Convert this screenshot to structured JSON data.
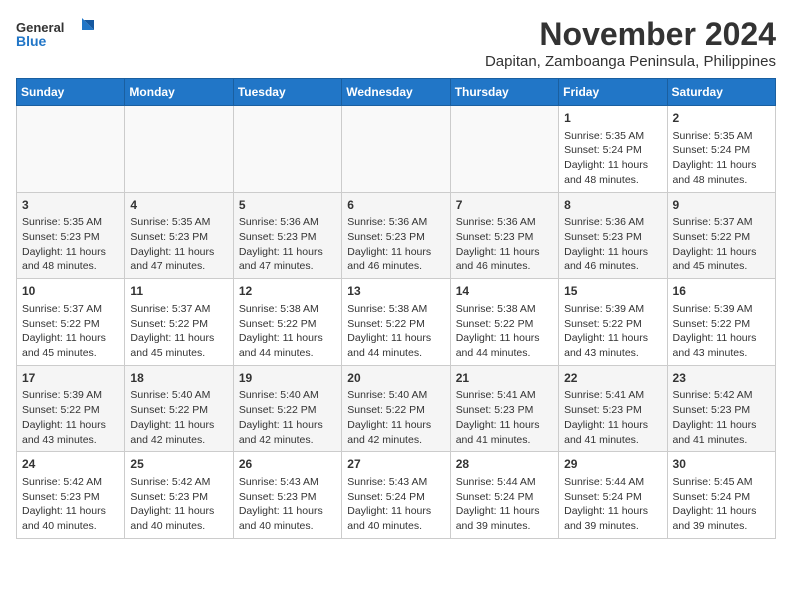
{
  "header": {
    "logo_line1": "General",
    "logo_line2": "Blue",
    "title": "November 2024",
    "subtitle": "Dapitan, Zamboanga Peninsula, Philippines"
  },
  "weekdays": [
    "Sunday",
    "Monday",
    "Tuesday",
    "Wednesday",
    "Thursday",
    "Friday",
    "Saturday"
  ],
  "weeks": [
    [
      {
        "day": "",
        "info": ""
      },
      {
        "day": "",
        "info": ""
      },
      {
        "day": "",
        "info": ""
      },
      {
        "day": "",
        "info": ""
      },
      {
        "day": "",
        "info": ""
      },
      {
        "day": "1",
        "info": "Sunrise: 5:35 AM\nSunset: 5:24 PM\nDaylight: 11 hours\nand 48 minutes."
      },
      {
        "day": "2",
        "info": "Sunrise: 5:35 AM\nSunset: 5:24 PM\nDaylight: 11 hours\nand 48 minutes."
      }
    ],
    [
      {
        "day": "3",
        "info": "Sunrise: 5:35 AM\nSunset: 5:23 PM\nDaylight: 11 hours\nand 48 minutes."
      },
      {
        "day": "4",
        "info": "Sunrise: 5:35 AM\nSunset: 5:23 PM\nDaylight: 11 hours\nand 47 minutes."
      },
      {
        "day": "5",
        "info": "Sunrise: 5:36 AM\nSunset: 5:23 PM\nDaylight: 11 hours\nand 47 minutes."
      },
      {
        "day": "6",
        "info": "Sunrise: 5:36 AM\nSunset: 5:23 PM\nDaylight: 11 hours\nand 46 minutes."
      },
      {
        "day": "7",
        "info": "Sunrise: 5:36 AM\nSunset: 5:23 PM\nDaylight: 11 hours\nand 46 minutes."
      },
      {
        "day": "8",
        "info": "Sunrise: 5:36 AM\nSunset: 5:23 PM\nDaylight: 11 hours\nand 46 minutes."
      },
      {
        "day": "9",
        "info": "Sunrise: 5:37 AM\nSunset: 5:22 PM\nDaylight: 11 hours\nand 45 minutes."
      }
    ],
    [
      {
        "day": "10",
        "info": "Sunrise: 5:37 AM\nSunset: 5:22 PM\nDaylight: 11 hours\nand 45 minutes."
      },
      {
        "day": "11",
        "info": "Sunrise: 5:37 AM\nSunset: 5:22 PM\nDaylight: 11 hours\nand 45 minutes."
      },
      {
        "day": "12",
        "info": "Sunrise: 5:38 AM\nSunset: 5:22 PM\nDaylight: 11 hours\nand 44 minutes."
      },
      {
        "day": "13",
        "info": "Sunrise: 5:38 AM\nSunset: 5:22 PM\nDaylight: 11 hours\nand 44 minutes."
      },
      {
        "day": "14",
        "info": "Sunrise: 5:38 AM\nSunset: 5:22 PM\nDaylight: 11 hours\nand 44 minutes."
      },
      {
        "day": "15",
        "info": "Sunrise: 5:39 AM\nSunset: 5:22 PM\nDaylight: 11 hours\nand 43 minutes."
      },
      {
        "day": "16",
        "info": "Sunrise: 5:39 AM\nSunset: 5:22 PM\nDaylight: 11 hours\nand 43 minutes."
      }
    ],
    [
      {
        "day": "17",
        "info": "Sunrise: 5:39 AM\nSunset: 5:22 PM\nDaylight: 11 hours\nand 43 minutes."
      },
      {
        "day": "18",
        "info": "Sunrise: 5:40 AM\nSunset: 5:22 PM\nDaylight: 11 hours\nand 42 minutes."
      },
      {
        "day": "19",
        "info": "Sunrise: 5:40 AM\nSunset: 5:22 PM\nDaylight: 11 hours\nand 42 minutes."
      },
      {
        "day": "20",
        "info": "Sunrise: 5:40 AM\nSunset: 5:22 PM\nDaylight: 11 hours\nand 42 minutes."
      },
      {
        "day": "21",
        "info": "Sunrise: 5:41 AM\nSunset: 5:23 PM\nDaylight: 11 hours\nand 41 minutes."
      },
      {
        "day": "22",
        "info": "Sunrise: 5:41 AM\nSunset: 5:23 PM\nDaylight: 11 hours\nand 41 minutes."
      },
      {
        "day": "23",
        "info": "Sunrise: 5:42 AM\nSunset: 5:23 PM\nDaylight: 11 hours\nand 41 minutes."
      }
    ],
    [
      {
        "day": "24",
        "info": "Sunrise: 5:42 AM\nSunset: 5:23 PM\nDaylight: 11 hours\nand 40 minutes."
      },
      {
        "day": "25",
        "info": "Sunrise: 5:42 AM\nSunset: 5:23 PM\nDaylight: 11 hours\nand 40 minutes."
      },
      {
        "day": "26",
        "info": "Sunrise: 5:43 AM\nSunset: 5:23 PM\nDaylight: 11 hours\nand 40 minutes."
      },
      {
        "day": "27",
        "info": "Sunrise: 5:43 AM\nSunset: 5:24 PM\nDaylight: 11 hours\nand 40 minutes."
      },
      {
        "day": "28",
        "info": "Sunrise: 5:44 AM\nSunset: 5:24 PM\nDaylight: 11 hours\nand 39 minutes."
      },
      {
        "day": "29",
        "info": "Sunrise: 5:44 AM\nSunset: 5:24 PM\nDaylight: 11 hours\nand 39 minutes."
      },
      {
        "day": "30",
        "info": "Sunrise: 5:45 AM\nSunset: 5:24 PM\nDaylight: 11 hours\nand 39 minutes."
      }
    ]
  ]
}
